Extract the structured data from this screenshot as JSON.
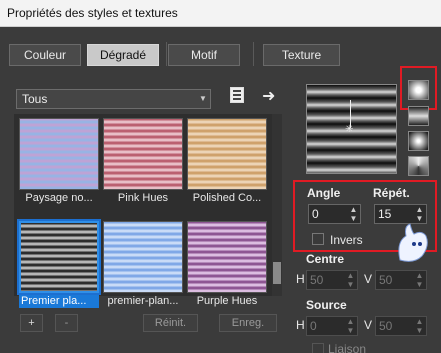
{
  "window": {
    "title": "Propriétés des styles et textures"
  },
  "tabs": [
    "Couleur",
    "Dégradé",
    "Motif",
    "Texture"
  ],
  "category": {
    "selected": "Tous"
  },
  "gallery": {
    "items": [
      {
        "label": "Paysage no...",
        "colors": [
          "#c79fd1",
          "#8fb7e8"
        ]
      },
      {
        "label": "Pink Hues",
        "colors": [
          "#b0485b",
          "#f3d6dc"
        ]
      },
      {
        "label": "Polished Co...",
        "colors": [
          "#c8955a",
          "#f3e0c8"
        ]
      },
      {
        "label": "Premier pla...",
        "colors": [
          "#0b0b0b",
          "#d8d8d8"
        ],
        "selected": true
      },
      {
        "label": "premier-plan...",
        "colors": [
          "#6e9be3",
          "#dbe8fb"
        ]
      },
      {
        "label": "Purple Hues",
        "colors": [
          "#7a3c80",
          "#f0d7f4"
        ]
      }
    ]
  },
  "buttons": {
    "add": "+",
    "remove": "-",
    "reset": "Réinit.",
    "save": "Enreg."
  },
  "angle": {
    "label": "Angle",
    "value": "0"
  },
  "repeat": {
    "label": "Répét.",
    "value": "15"
  },
  "invert": {
    "label": "Invers",
    "checked": false
  },
  "center": {
    "label": "Centre",
    "h_label": "H",
    "h": "50",
    "v_label": "V",
    "v": "50"
  },
  "source": {
    "label": "Source",
    "h_label": "H",
    "h": "0",
    "v_label": "V",
    "v": "50"
  },
  "link": {
    "label": "Liaison"
  },
  "colors": {
    "accent": "#1a79d8",
    "highlight": "#e01b24"
  }
}
